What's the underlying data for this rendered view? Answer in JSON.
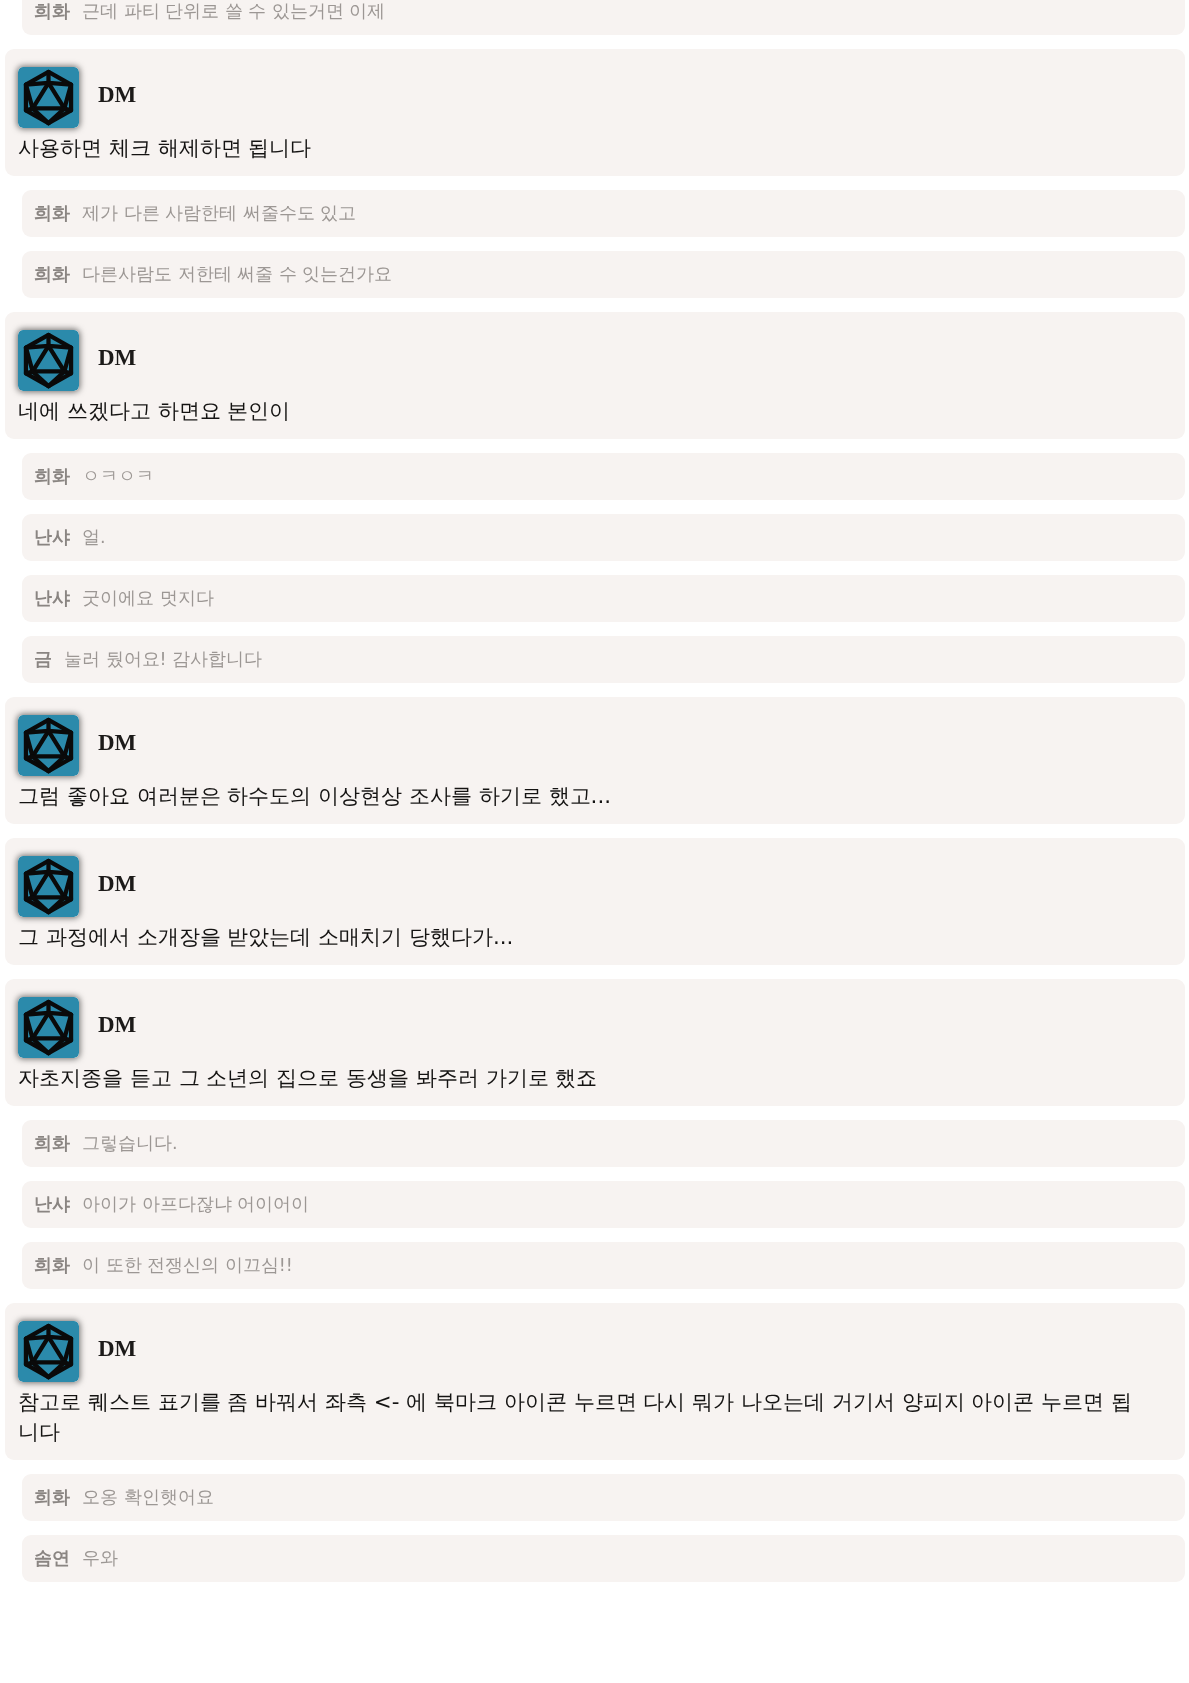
{
  "messages": [
    {
      "kind": "chat",
      "author": "희화",
      "text": "근데 파티 단위로 쓸 수 있는거면 이제"
    },
    {
      "kind": "post",
      "author": "DM",
      "text": "사용하면 체크 해제하면 됩니다"
    },
    {
      "kind": "chat",
      "author": "희화",
      "text": "제가 다른 사람한테 써줄수도 있고"
    },
    {
      "kind": "chat",
      "author": "희화",
      "text": "다른사람도 저한테 써줄 수 잇는건가요"
    },
    {
      "kind": "post",
      "author": "DM",
      "text": "네에 쓰겠다고 하면요 본인이"
    },
    {
      "kind": "chat",
      "author": "희화",
      "text": "ㅇㅋㅇㅋ"
    },
    {
      "kind": "chat",
      "author": "난샤",
      "text": "얼."
    },
    {
      "kind": "chat",
      "author": "난샤",
      "text": "굿이에요 멋지다"
    },
    {
      "kind": "chat",
      "author": "금",
      "text": "눌러 뒀어요! 감사합니다"
    },
    {
      "kind": "post",
      "author": "DM",
      "text": "그럼 좋아요 여러분은 하수도의 이상현상 조사를 하기로 했고..."
    },
    {
      "kind": "post",
      "author": "DM",
      "text": "그 과정에서 소개장을 받았는데 소매치기 당했다가..."
    },
    {
      "kind": "post",
      "author": "DM",
      "text": "자초지종을 듣고 그 소년의 집으로 동생을 봐주러 가기로 했죠"
    },
    {
      "kind": "chat",
      "author": "희화",
      "text": "그렇습니다."
    },
    {
      "kind": "chat",
      "author": "난샤",
      "text": "아이가 아프다잖냐 어이어이"
    },
    {
      "kind": "chat",
      "author": "희화",
      "text": "이 또한 전쟁신의 이끄심!!"
    },
    {
      "kind": "post",
      "author": "DM",
      "text": "참고로 퀘스트 표기를 좀 바꿔서 좌측 <- 에 북마크 아이콘 누르면 다시 뭐가 나오는데 거기서 양피지 아이콘 누르면 됩니다"
    },
    {
      "kind": "chat",
      "author": "희화",
      "text": "오옹 확인햇어요"
    },
    {
      "kind": "chat",
      "author": "솜연",
      "text": "우와"
    }
  ]
}
